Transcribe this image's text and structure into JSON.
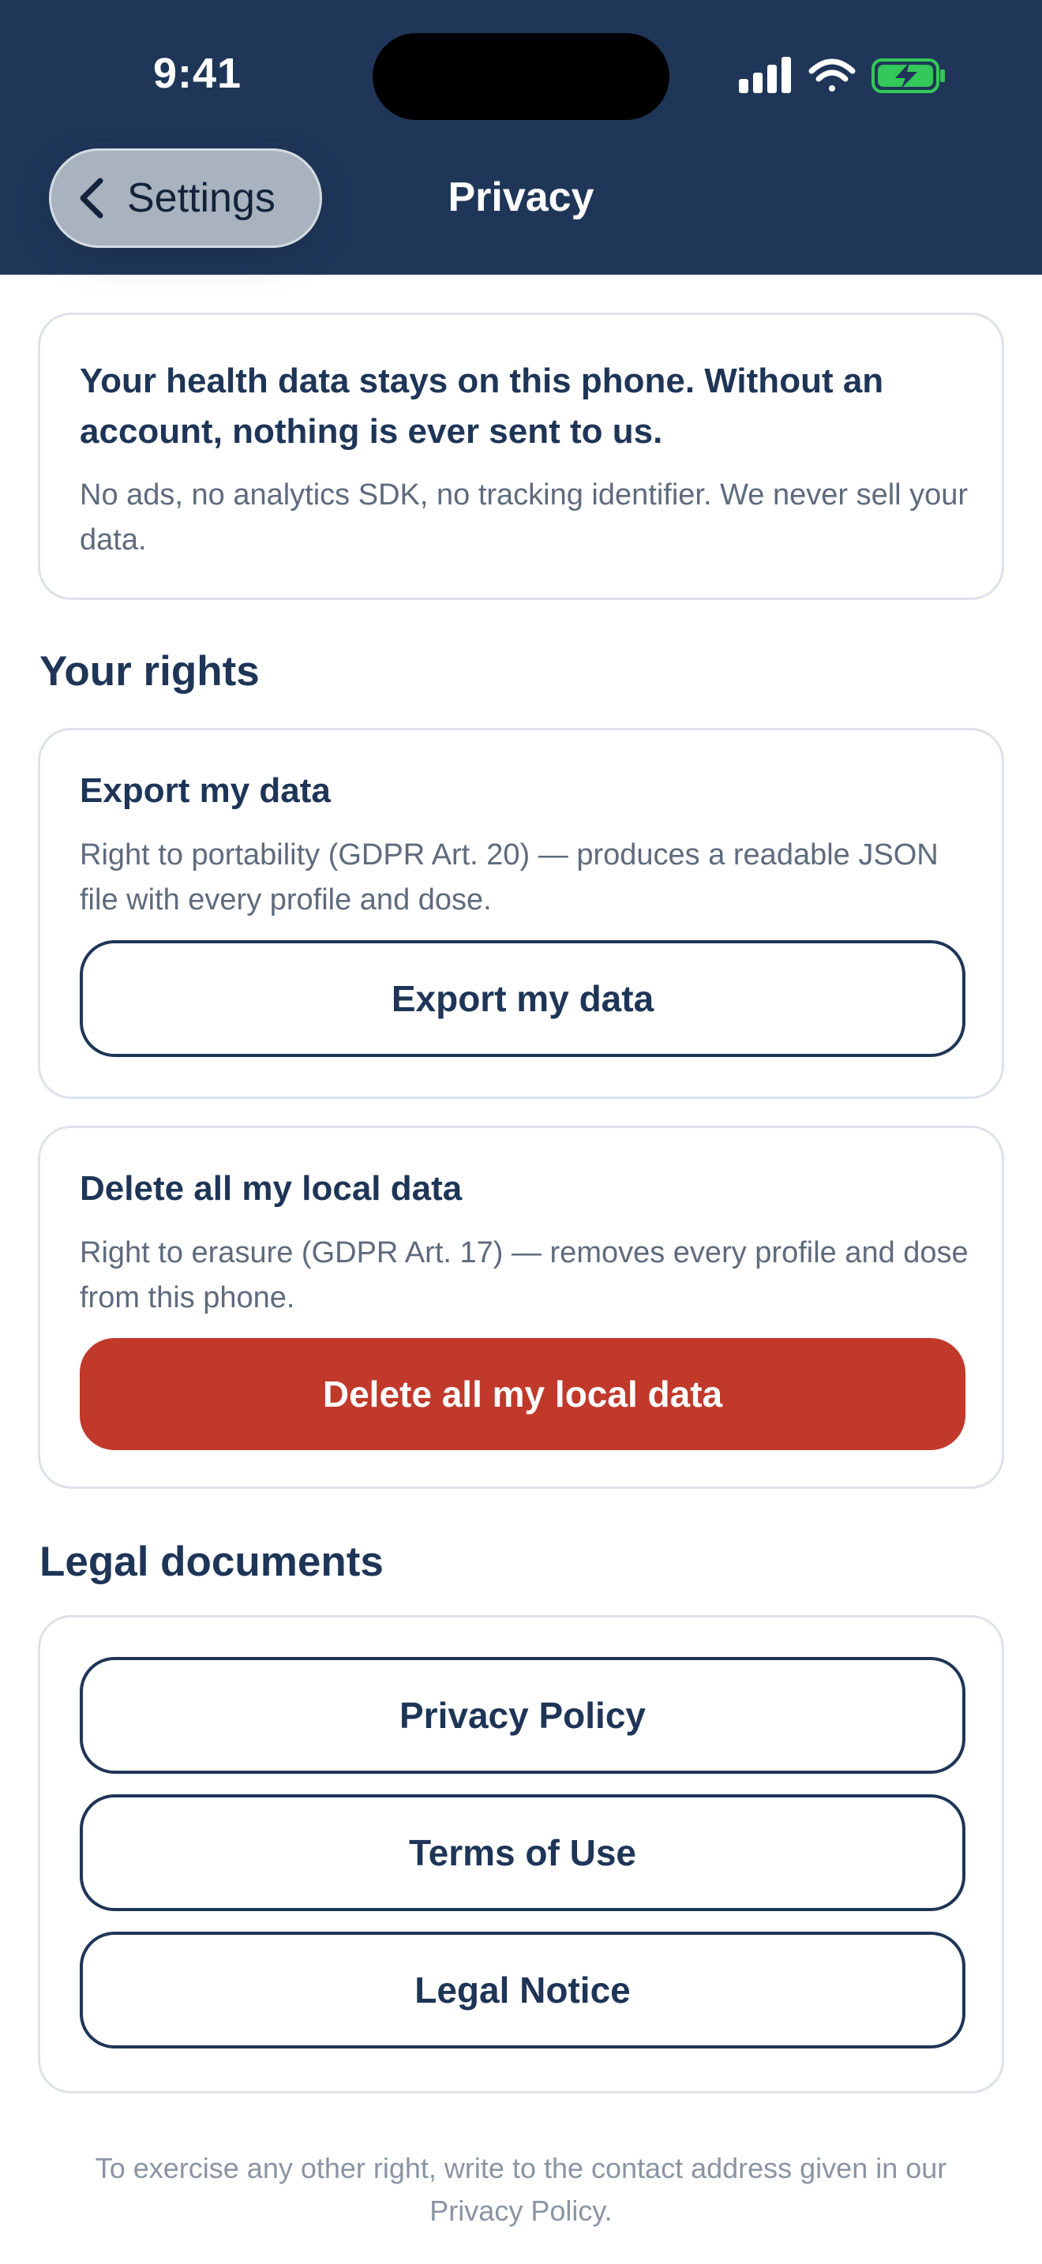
{
  "status_bar": {
    "time": "9:41",
    "icons": [
      "cellular-signal-icon",
      "wifi-icon",
      "battery-charging-icon"
    ],
    "battery_color": "#34c759"
  },
  "nav": {
    "back_label": "Settings",
    "title": "Privacy"
  },
  "intro": {
    "title": "Your health data stays on this phone. Without an account, nothing is ever sent to us.",
    "body": "No ads, no analytics SDK, no tracking identifier. We never sell your data."
  },
  "rights": {
    "heading": "Your rights",
    "export": {
      "title": "Export my data",
      "description": "Right to portability (GDPR Art. 20) — produces a readable JSON file with every profile and dose.",
      "button": "Export my data"
    },
    "delete": {
      "title": "Delete all my local data",
      "description": "Right to erasure (GDPR Art. 17) — removes every profile and dose from this phone.",
      "button": "Delete all my local data"
    }
  },
  "legal": {
    "heading": "Legal documents",
    "links": [
      "Privacy Policy",
      "Terms of Use",
      "Legal Notice"
    ]
  },
  "footer": {
    "note": "To exercise any other right, write to the contact address given in our Privacy Policy."
  },
  "colors": {
    "header": "#1f3658",
    "text": "#1e3557",
    "danger": "#c0392b"
  }
}
